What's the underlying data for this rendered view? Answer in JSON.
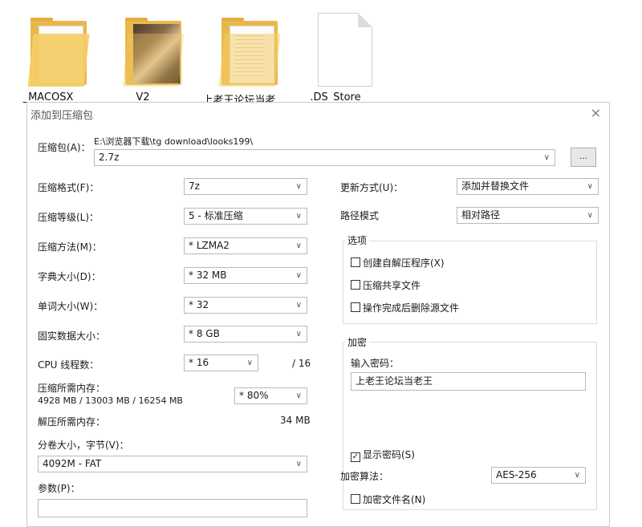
{
  "desktop": {
    "icons": [
      {
        "label": "_MACOSX",
        "kind": "folder"
      },
      {
        "label": "V2",
        "kind": "photo-folder"
      },
      {
        "label": "上老王论坛当老",
        "kind": "docs-folder"
      },
      {
        "label": ".DS_Store",
        "kind": "file"
      }
    ]
  },
  "dialog": {
    "title": "添加到压缩包",
    "close_icon": "×",
    "archive": {
      "label": "压缩包(A)：",
      "path": "E:\\浏览器下载\\tg download\\looks199\\",
      "filename": "2.7z",
      "browse_label": "..."
    },
    "left": {
      "format": {
        "label": "压缩格式(F)：",
        "value": "7z"
      },
      "level": {
        "label": "压缩等级(L)：",
        "value": "5 - 标准压缩"
      },
      "method": {
        "label": "压缩方法(M)：",
        "value": "* LZMA2"
      },
      "dict": {
        "label": "字典大小(D)：",
        "value": "* 32 MB"
      },
      "word": {
        "label": "单词大小(W)：",
        "value": "* 32"
      },
      "solid": {
        "label": "固实数据大小：",
        "value": "* 8 GB"
      },
      "threads": {
        "label": "CPU 线程数：",
        "value": "* 16",
        "max": "/ 16"
      },
      "mem_compress": {
        "label": "压缩所需内存：",
        "detail": "4928 MB / 13003 MB / 16254 MB",
        "value": "* 80%"
      },
      "mem_decompress": {
        "label": "解压所需内存：",
        "value": "34 MB"
      },
      "volume": {
        "label": "分卷大小，字节(V)：",
        "value": "4092M - FAT"
      },
      "params": {
        "label": "参数(P)：",
        "value": ""
      }
    },
    "right": {
      "update": {
        "label": "更新方式(U)：",
        "value": "添加并替换文件"
      },
      "path_mode": {
        "label": "路径模式",
        "value": "相对路径"
      },
      "options": {
        "title": "选项",
        "sfx": {
          "label": "创建自解压程序(X)",
          "checked": false
        },
        "shared": {
          "label": "压缩共享文件",
          "checked": false
        },
        "delete": {
          "label": "操作完成后删除源文件",
          "checked": false
        }
      },
      "encryption": {
        "title": "加密",
        "password_label": "输入密码：",
        "password_value": "上老王论坛当老王",
        "show_password": {
          "label": "显示密码(S)",
          "checked": true
        },
        "method_label": "加密算法：",
        "method_value": "AES-256",
        "encrypt_names": {
          "label": "加密文件名(N)",
          "checked": false
        }
      }
    }
  }
}
